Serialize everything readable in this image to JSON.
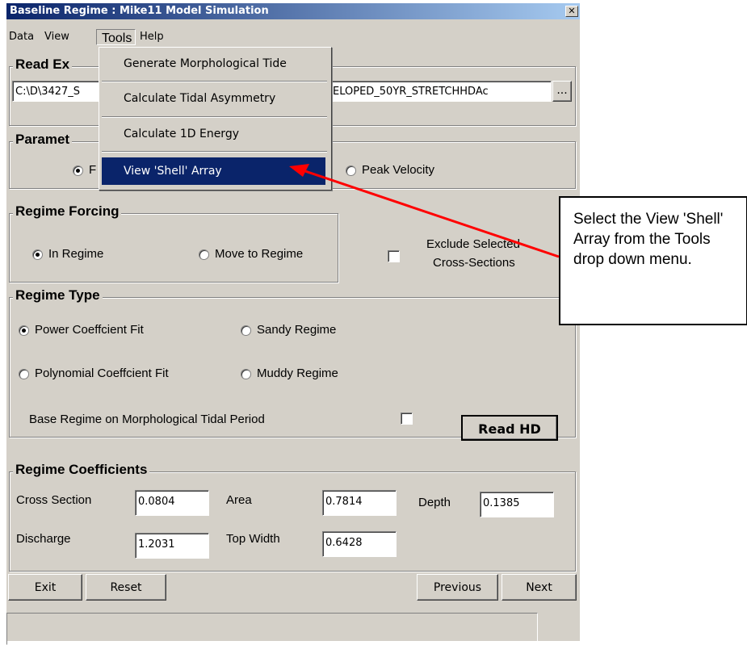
{
  "window": {
    "title": "Baseline Regime : Mike11 Model Simulation",
    "close_glyph": "✕"
  },
  "menubar": [
    "Data",
    "View",
    "Tools",
    "Help"
  ],
  "tools_menu": {
    "items": [
      "Generate Morphological Tide",
      "Calculate Tidal Asymmetry",
      "Calculate 1D Energy",
      "View 'Shell' Array"
    ],
    "selected_index": 3
  },
  "read_extract": {
    "title": "Read Ex",
    "path_left": "C:\\D\\3427_S",
    "path_right": "ELOPED_50YR_STRETCHHDAc",
    "browse_label": "..."
  },
  "parameters": {
    "title": "Paramet",
    "option_left": "F",
    "option_right": "Peak Velocity",
    "selected": "left"
  },
  "regime_forcing": {
    "title": "Regime Forcing",
    "in_regime": "In Regime",
    "move_to_regime": "Move to Regime",
    "selected": "in_regime",
    "exclude_line1": "Exclude Selected",
    "exclude_line2": "Cross-Sections",
    "exclude_checked": false
  },
  "regime_type": {
    "title": "Regime Type",
    "power": "Power Coeffcient Fit",
    "sandy": "Sandy Regime",
    "polynomial": "Polynomial Coeffcient Fit",
    "muddy": "Muddy Regime",
    "selected": "power",
    "base_label": "Base Regime on Morphological Tidal Period",
    "base_checked": false,
    "read_hd_label": "Read HD"
  },
  "coefficients": {
    "title": "Regime Coefficients",
    "cross_section_label": "Cross Section",
    "cross_section_value": "0.0804",
    "area_label": "Area",
    "area_value": "0.7814",
    "depth_label": "Depth",
    "depth_value": "0.1385",
    "discharge_label": "Discharge",
    "discharge_value": "1.2031",
    "top_width_label": "Top Width",
    "top_width_value": "0.6428"
  },
  "buttons": {
    "exit": "Exit",
    "reset": "Reset",
    "previous": "Previous",
    "next": "Next"
  },
  "callout": {
    "text": "Select the View 'Shell' Array from the Tools drop down menu.",
    "arrow_color": "#ff0000"
  }
}
